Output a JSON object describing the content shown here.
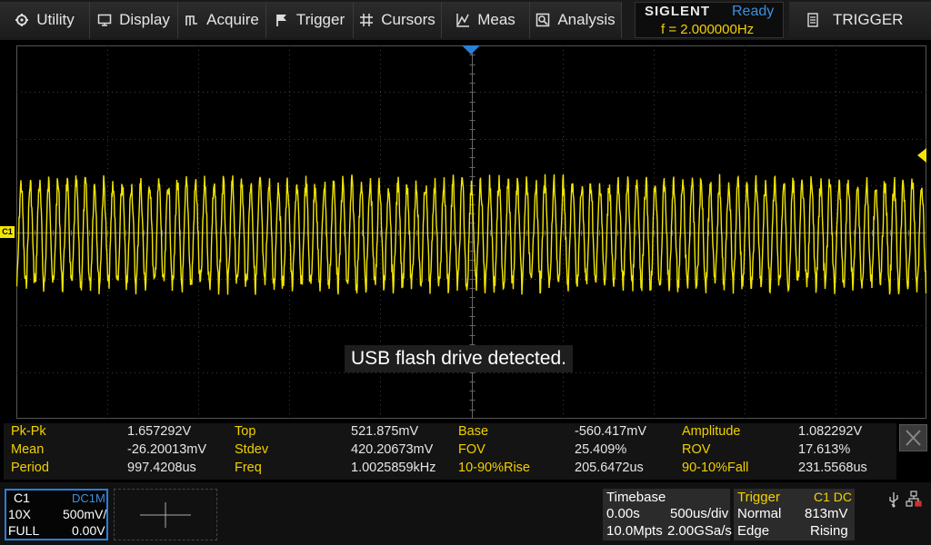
{
  "menu": {
    "items": [
      {
        "label": "Utility",
        "icon": "utility-icon"
      },
      {
        "label": "Display",
        "icon": "display-icon"
      },
      {
        "label": "Acquire",
        "icon": "acquire-icon"
      },
      {
        "label": "Trigger",
        "icon": "trigger-flag-icon"
      },
      {
        "label": "Cursors",
        "icon": "cursors-icon"
      },
      {
        "label": "Meas",
        "icon": "meas-icon"
      },
      {
        "label": "Analysis",
        "icon": "analysis-icon"
      }
    ]
  },
  "brand": {
    "name": "SIGLENT",
    "status": "Ready",
    "frequency": "f = 2.000000Hz"
  },
  "panel": {
    "label": "TRIGGER",
    "icon": "list-icon"
  },
  "channel_marker": "C1",
  "toast": "USB flash drive detected.",
  "measurements": [
    [
      {
        "label": "Pk-Pk",
        "value": "1.657292V"
      },
      {
        "label": "Top",
        "value": "521.875mV"
      },
      {
        "label": "Base",
        "value": "-560.417mV"
      },
      {
        "label": "Amplitude",
        "value": "1.082292V"
      }
    ],
    [
      {
        "label": "Mean",
        "value": "-26.20013mV"
      },
      {
        "label": "Stdev",
        "value": "420.20673mV"
      },
      {
        "label": "FOV",
        "value": "25.409%"
      },
      {
        "label": "ROV",
        "value": "17.613%"
      }
    ],
    [
      {
        "label": "Period",
        "value": "997.4208us"
      },
      {
        "label": "Freq",
        "value": "1.0025859kHz"
      },
      {
        "label": "10-90%Rise",
        "value": "205.6472us"
      },
      {
        "label": "90-10%Fall",
        "value": "231.5568us"
      }
    ]
  ],
  "channel": {
    "name": "C1",
    "coupling": "DC1M",
    "probe": "10X",
    "scale": "500mV/",
    "bandwidth": "FULL",
    "offset": "0.00V"
  },
  "timebase": {
    "title": "Timebase",
    "delay": "0.00s",
    "scale": "500us/div",
    "memory": "10.0Mpts",
    "sample_rate": "2.00GSa/s"
  },
  "trigger": {
    "title": "Trigger",
    "source": "C1 DC",
    "mode": "Normal",
    "level": "813mV",
    "type": "Edge",
    "slope": "Rising"
  },
  "colors": {
    "trace": "#f2e600",
    "label": "#f2d000",
    "accent": "#2a7fd8",
    "status": "#3f8fe0"
  }
}
